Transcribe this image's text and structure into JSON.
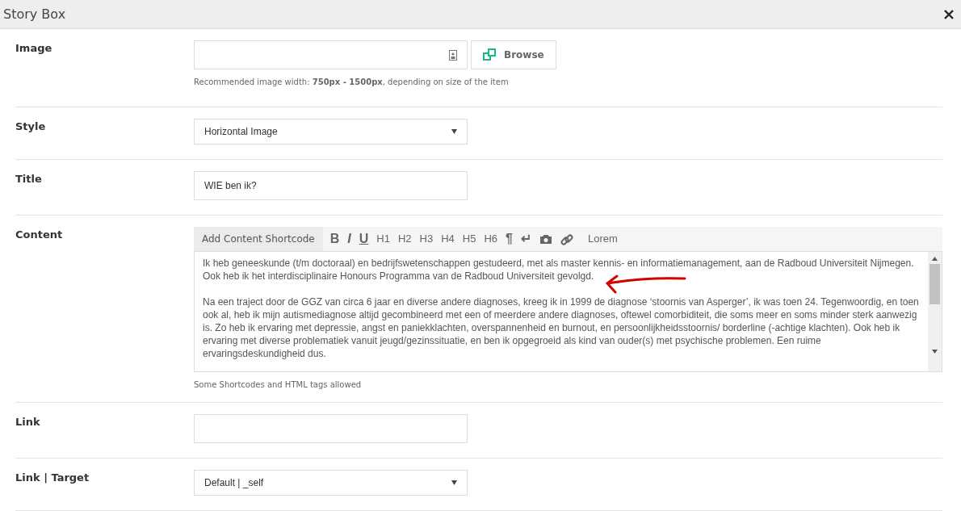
{
  "window": {
    "title": "Story Box"
  },
  "fields": [
    {
      "kind": "image",
      "label": "Image",
      "button": "Browse",
      "help": "Recommended image width: **750px - 1500px**, depending on size of the item"
    },
    {
      "kind": "select",
      "label": "Style",
      "value": "Horizontal Image"
    },
    {
      "kind": "text",
      "label": "Title",
      "value": "WIE ben ik?"
    },
    {
      "kind": "editor",
      "label": "Content",
      "shortcode_button": "Add Content Shortcode",
      "toolbar": [
        "B",
        "I",
        "U",
        "H1",
        "H2",
        "H3",
        "H4",
        "H5",
        "H6",
        "¶",
        "↵"
      ],
      "extra_button": "Lorem",
      "value": [
        "Ik heb geneeskunde (t/m doctoraal) en bedrijfswetenschappen gestudeerd, met als master kennis- en informatiemanagement, aan de Radboud Universiteit Nijmegen. Ook heb ik het interdisciplinaire Honours Programma van de Radboud Universiteit gevolgd.",
        "Na een traject door de GGZ van circa 6 jaar en diverse andere diagnoses, kreeg ik in 1999 de diagnose ‘stoornis van Asperger’, ik was toen 24. Tegenwoordig, en toen ook al, heb ik mijn autismediagnose altijd gecombineerd met een of meerdere andere diagnoses, oftewel comorbiditeit, die soms meer en soms minder sterk aanwezig is. Zo heb ik ervaring met depressie, angst en paniekklachten, overspannenheid en burnout, en persoonlijkheidsstoornis/ borderline (-achtige klachten). Ook heb ik ervaring met diverse problematiek vanuit jeugd/gezinssituatie, en ben ik opgegroeid als kind van ouder(s) met psychische problemen. Een ruime ervaringsdeskundigheid dus."
      ],
      "help": "Some Shortcodes and HTML tags allowed"
    },
    {
      "kind": "text",
      "label": "Link"
    },
    {
      "kind": "select",
      "label": "Link | Target",
      "value": "Default | _self"
    }
  ]
}
